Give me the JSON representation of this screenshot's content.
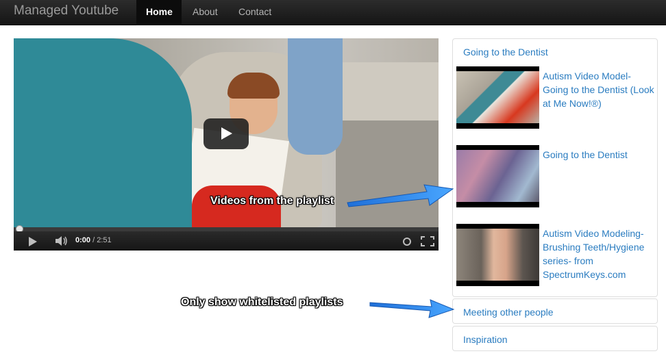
{
  "navbar": {
    "brand": "Managed Youtube",
    "items": [
      {
        "label": "Home",
        "active": true
      },
      {
        "label": "About",
        "active": false
      },
      {
        "label": "Contact",
        "active": false
      }
    ]
  },
  "player": {
    "current_time": "0:00",
    "duration": " / 2:51",
    "progress": 0
  },
  "sidebar": {
    "playlists": [
      {
        "title": "Going to the Dentist",
        "videos": [
          {
            "title": "Autism Video Model- Going to the Dentist (Look at Me Now!®)"
          },
          {
            "title": "Going to the Dentist"
          },
          {
            "title": "Autism Video Modeling- Brushing Teeth/Hygiene series- from SpectrumKeys.com"
          }
        ]
      },
      {
        "title": "Meeting other people"
      },
      {
        "title": "Inspiration"
      }
    ]
  },
  "annotations": {
    "playlist_videos": "Videos from the playlist",
    "whitelist": "Only show whitelisted playlists"
  },
  "colors": {
    "link": "#2a7cc0",
    "navbar": "#1b1b1b",
    "arrow": "#2f8cf0"
  }
}
